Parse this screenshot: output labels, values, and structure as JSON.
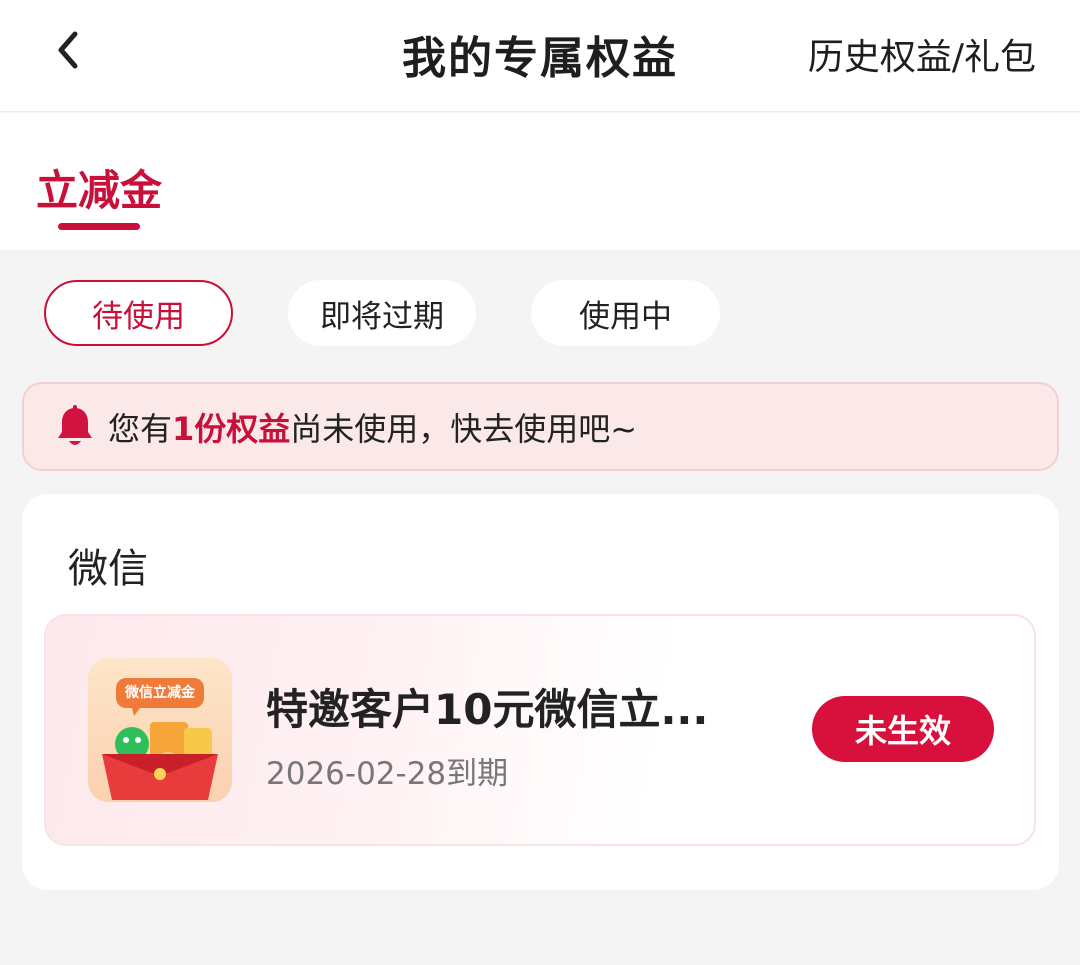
{
  "header": {
    "title": "我的专属权益",
    "history_link": "历史权益/礼包",
    "back_icon": "chevron-left-icon"
  },
  "tabs": [
    {
      "label": "立减金",
      "active": true
    }
  ],
  "filters": [
    {
      "label": "待使用",
      "selected": true
    },
    {
      "label": "即将过期",
      "selected": false
    },
    {
      "label": "使用中",
      "selected": false
    }
  ],
  "notice": {
    "icon": "bell-icon",
    "prefix": "您有",
    "highlight": "1份权益",
    "suffix": "尚未使用，快去使用吧~"
  },
  "group": {
    "title": "微信",
    "coupons": [
      {
        "thumb_label": "微信立减金",
        "name": "特邀客户10元微信立...",
        "expiry": "2026-02-28到期",
        "status": "未生效"
      }
    ]
  },
  "colors": {
    "accent": "#c8103a",
    "button": "#d8103c",
    "notice_bg": "#fbe9ea",
    "page_bg": "#f4f4f4"
  }
}
